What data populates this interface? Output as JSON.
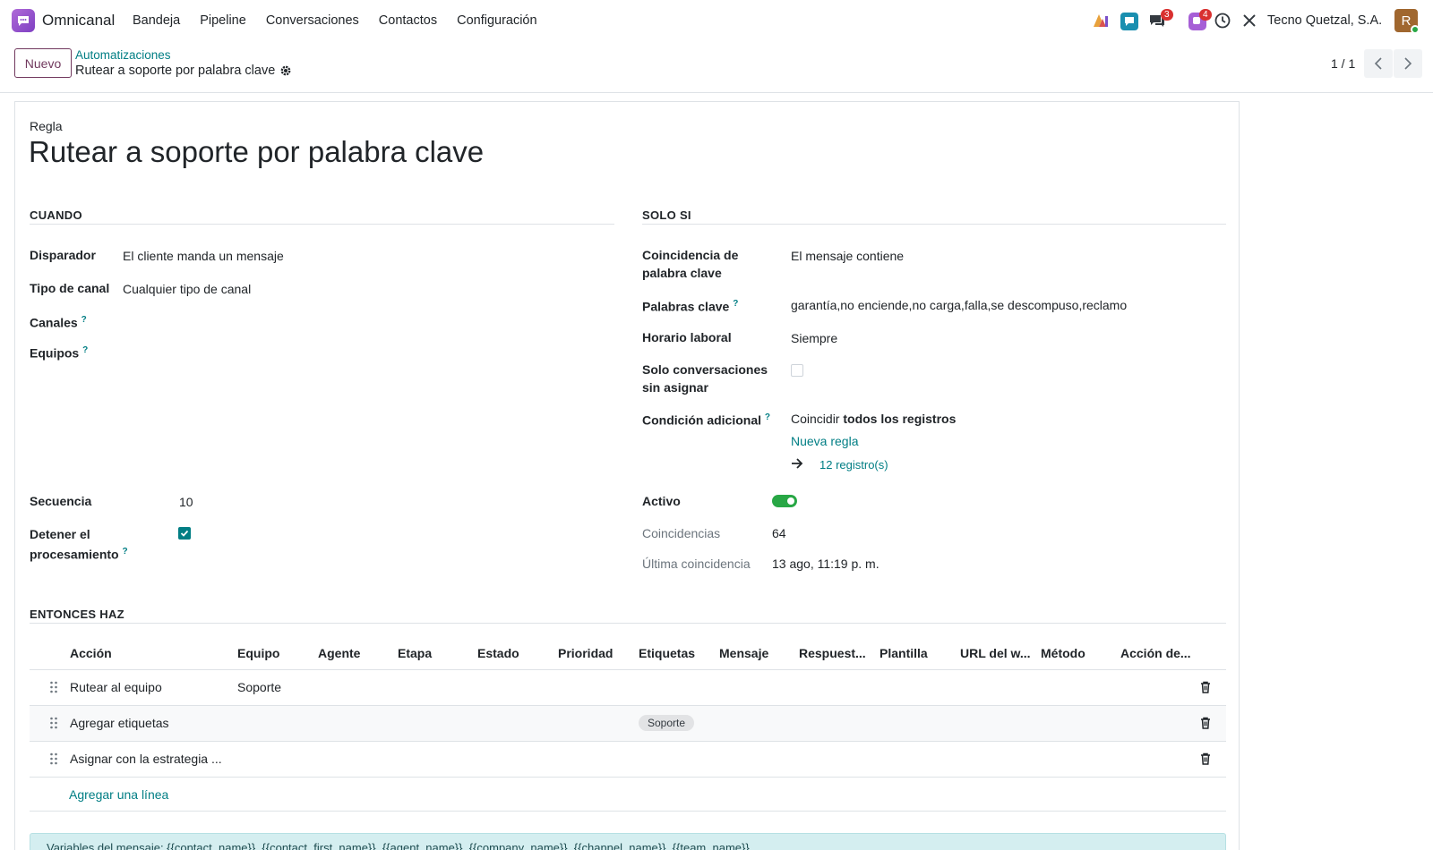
{
  "navbar": {
    "app_name": "Omnicanal",
    "menu": [
      "Bandeja",
      "Pipeline",
      "Conversaciones",
      "Contactos",
      "Configuración"
    ],
    "badges": {
      "messages": "3",
      "activities": "4"
    },
    "company": "Tecno Quetzal, S.A.",
    "avatar_initial": "R"
  },
  "control": {
    "new_button": "Nuevo",
    "breadcrumb_parent": "Automatizaciones",
    "breadcrumb_current": "Rutear a soporte por palabra clave",
    "pager": "1 / 1"
  },
  "form": {
    "label_top": "Regla",
    "title": "Rutear a soporte por palabra clave",
    "when": {
      "section": "CUANDO",
      "trigger_label": "Disparador",
      "trigger_value": "El cliente manda un mensaje",
      "channel_type_label": "Tipo de canal",
      "channel_type_value": "Cualquier tipo de canal",
      "channels_label": "Canales",
      "teams_label": "Equipos",
      "sequence_label": "Secuencia",
      "sequence_value": "10",
      "stop_label_1": "Detener el",
      "stop_label_2": "procesamiento"
    },
    "only_if": {
      "section": "SOLO SI",
      "keyword_match_label_1": "Coincidencia de",
      "keyword_match_label_2": "palabra clave",
      "keyword_match_value": "El mensaje contiene",
      "keywords_label": "Palabras clave",
      "keywords_value": "garantía,no enciende,no carga,falla,se descompuso,reclamo",
      "hours_label": "Horario laboral",
      "hours_value": "Siempre",
      "unassigned_label_1": "Solo conversaciones",
      "unassigned_label_2": "sin asignar",
      "extra_label": "Condición adicional",
      "extra_prefix": "Coincidir",
      "extra_bold": "todos los registros",
      "new_rule": "Nueva regla",
      "records": "12 registro(s)",
      "active_label": "Activo",
      "matches_label": "Coincidencias",
      "matches_value": "64",
      "last_match_label": "Última coincidencia",
      "last_match_value": "13 ago, 11:19 p. m."
    },
    "then": {
      "section": "ENTONCES HAZ",
      "columns": [
        "Acción",
        "Equipo",
        "Agente",
        "Etapa",
        "Estado",
        "Prioridad",
        "Etiquetas",
        "Mensaje",
        "Respuest...",
        "Plantilla",
        "URL del w...",
        "Método",
        "Acción de..."
      ],
      "rows": [
        {
          "action": "Rutear al equipo",
          "team": "Soporte",
          "tag": ""
        },
        {
          "action": "Agregar etiquetas",
          "team": "",
          "tag": "Soporte"
        },
        {
          "action": "Asignar con la estrategia ...",
          "team": "",
          "tag": ""
        }
      ],
      "add_line": "Agregar una línea"
    },
    "alert": "Variables del mensaje: {{contact_name}}, {{contact_first_name}}, {{agent_name}}, {{company_name}}, {{channel_name}}, {{team_name}}"
  },
  "colors": {
    "brand": "#71395e",
    "accent": "#017e84",
    "toggle_on": "#28a745"
  }
}
